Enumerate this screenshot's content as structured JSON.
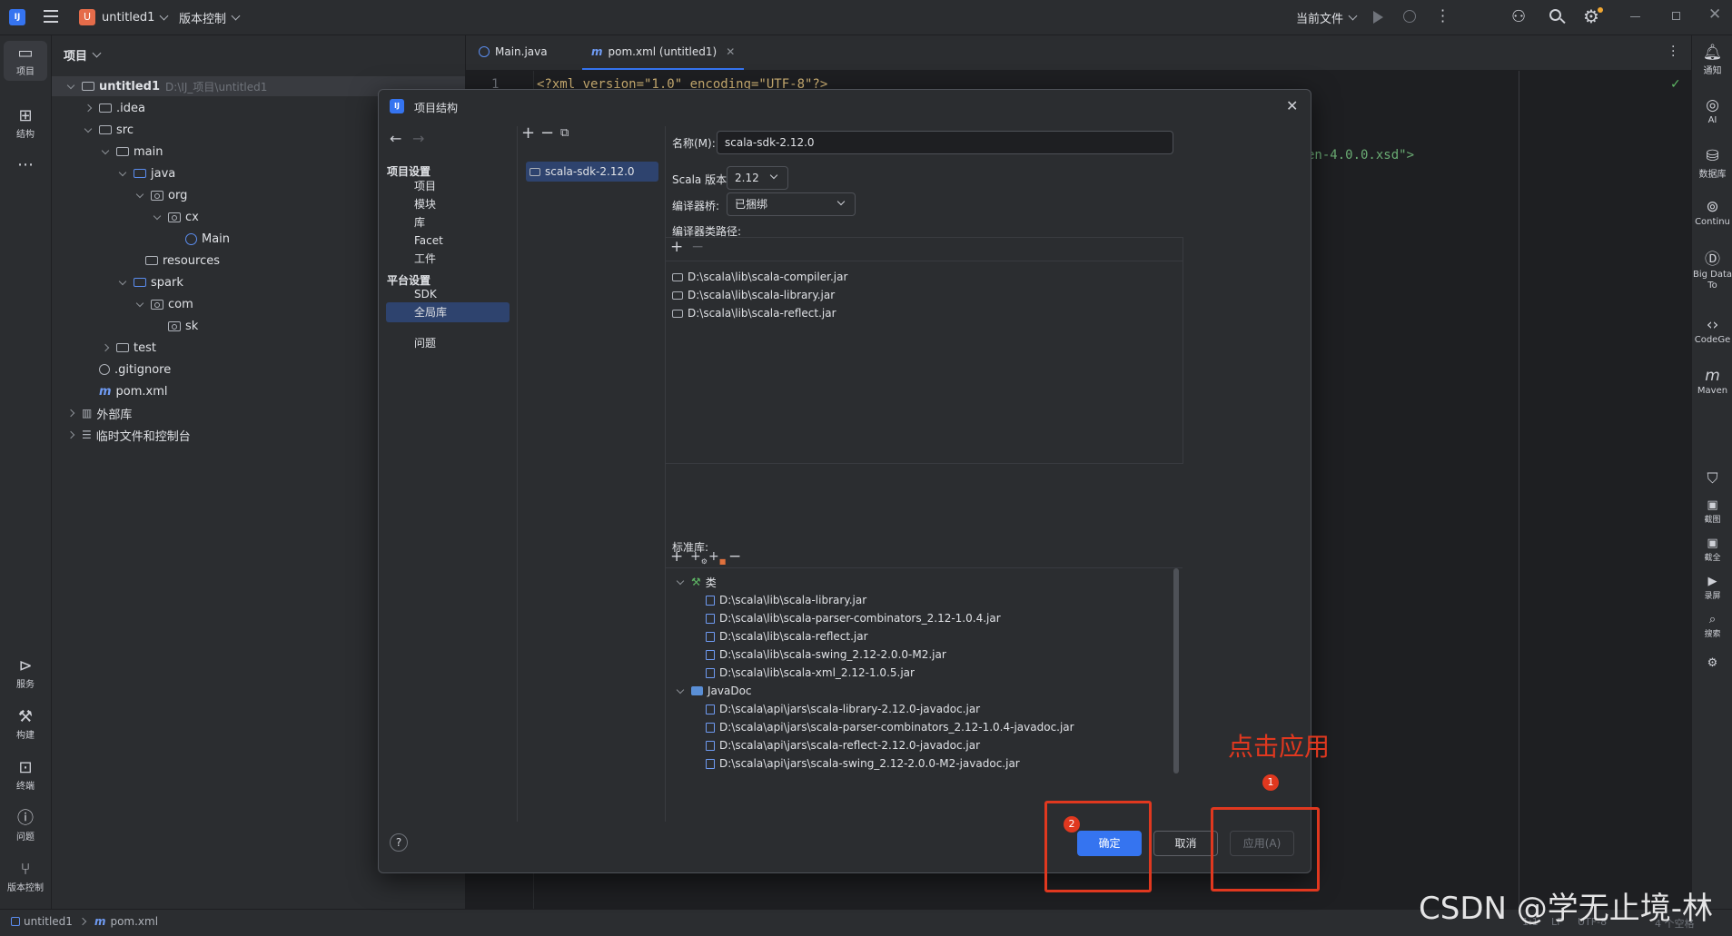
{
  "titlebar": {
    "project_badge": "U",
    "project_name": "untitled1",
    "vcs_label": "版本控制",
    "run_config": "当前文件"
  },
  "left_toolbar": {
    "items": [
      {
        "label": "项目",
        "icon": "folder-icon"
      },
      {
        "label": "结构",
        "icon": "structure-icon"
      }
    ],
    "bottom_items": [
      {
        "label": "服务",
        "icon": "services-icon"
      },
      {
        "label": "构建",
        "icon": "build-icon"
      },
      {
        "label": "终端",
        "icon": "terminal-icon"
      },
      {
        "label": "问题",
        "icon": "problems-icon"
      },
      {
        "label": "版本控制",
        "icon": "git-icon"
      }
    ]
  },
  "right_toolbar": {
    "items": [
      {
        "label": "通知",
        "icon": "bell-icon"
      },
      {
        "label": "AI",
        "icon": "ai-icon"
      },
      {
        "label": "数据库",
        "icon": "database-icon"
      },
      {
        "label": "Continu",
        "icon": "continue-icon"
      },
      {
        "label": "Big Data To",
        "icon": "bigdata-icon"
      },
      {
        "label": "CodeGe",
        "icon": "codegeex-icon"
      },
      {
        "label": "Maven",
        "icon": "maven-icon"
      }
    ],
    "lower_items": [
      "截图",
      "截全",
      "录屏",
      "搜索"
    ]
  },
  "project_panel": {
    "title": "项目",
    "tree": [
      {
        "label": "untitled1",
        "path": "D:\\IJ_项目\\untitled1",
        "bold": true
      },
      {
        "label": ".idea"
      },
      {
        "label": "src"
      },
      {
        "label": "main"
      },
      {
        "label": "java"
      },
      {
        "label": "org"
      },
      {
        "label": "cx"
      },
      {
        "label": "Main"
      },
      {
        "label": "resources"
      },
      {
        "label": "spark"
      },
      {
        "label": "com"
      },
      {
        "label": "sk"
      },
      {
        "label": "test"
      },
      {
        "label": ".gitignore"
      },
      {
        "label": "pom.xml"
      },
      {
        "label": "外部库"
      },
      {
        "label": "临时文件和控制台"
      }
    ]
  },
  "editor": {
    "tabs": [
      {
        "label": "Main.java"
      },
      {
        "label": "pom.xml (untitled1)"
      }
    ],
    "line1_number": "1",
    "line1_code": "<?xml version=\"1.0\" encoding=\"UTF-8\"?>",
    "visible_fragment": "en-4.0.0.xsd\">"
  },
  "dialog": {
    "title": "项目结构",
    "nav": {
      "project_settings_header": "项目设置",
      "project_settings": [
        "项目",
        "模块",
        "库",
        "Facet",
        "工件"
      ],
      "platform_settings_header": "平台设置",
      "platform_settings": [
        "SDK",
        "全局库"
      ],
      "selected": "全局库",
      "problems": "问题"
    },
    "library_list": [
      "scala-sdk-2.12.0"
    ],
    "name_label": "名称(M):",
    "name_value": "scala-sdk-2.12.0",
    "scala_version_label": "Scala 版本:",
    "scala_version_value": "2.12",
    "compiler_bridge_label": "编译器桥:",
    "compiler_bridge_value": "已捆绑",
    "compiler_classpath_label": "编译器类路径:",
    "compiler_classpath": [
      "D:\\scala\\lib\\scala-compiler.jar",
      "D:\\scala\\lib\\scala-library.jar",
      "D:\\scala\\lib\\scala-reflect.jar"
    ],
    "standard_library_label": "标准库:",
    "classes_label": "类",
    "classes": [
      "D:\\scala\\lib\\scala-library.jar",
      "D:\\scala\\lib\\scala-parser-combinators_2.12-1.0.4.jar",
      "D:\\scala\\lib\\scala-reflect.jar",
      "D:\\scala\\lib\\scala-swing_2.12-2.0.0-M2.jar",
      "D:\\scala\\lib\\scala-xml_2.12-1.0.5.jar"
    ],
    "javadoc_label": "JavaDoc",
    "javadocs": [
      "D:\\scala\\api\\jars\\scala-library-2.12.0-javadoc.jar",
      "D:\\scala\\api\\jars\\scala-parser-combinators_2.12-1.0.4-javadoc.jar",
      "D:\\scala\\api\\jars\\scala-reflect-2.12.0-javadoc.jar",
      "D:\\scala\\api\\jars\\scala-swing_2.12-2.0.0-M2-javadoc.jar"
    ],
    "ok_label": "确定",
    "cancel_label": "取消",
    "apply_label": "应用(A)",
    "help_label": "?"
  },
  "annotations": {
    "click_apply": "点击应用",
    "badge1": "1",
    "badge2": "2",
    "color": "#e0381f"
  },
  "statusbar": {
    "project": "untitled1",
    "file": "pom.xml",
    "position": "1:1",
    "line_sep": "LF",
    "encoding": "UTF-8",
    "indent": "4 个空格"
  },
  "watermark": "CSDN @学无止境-林",
  "colors": {
    "accent": "#3574f0",
    "selection": "#2e436e",
    "bg": "#1e1f22",
    "panel": "#2b2d30"
  }
}
